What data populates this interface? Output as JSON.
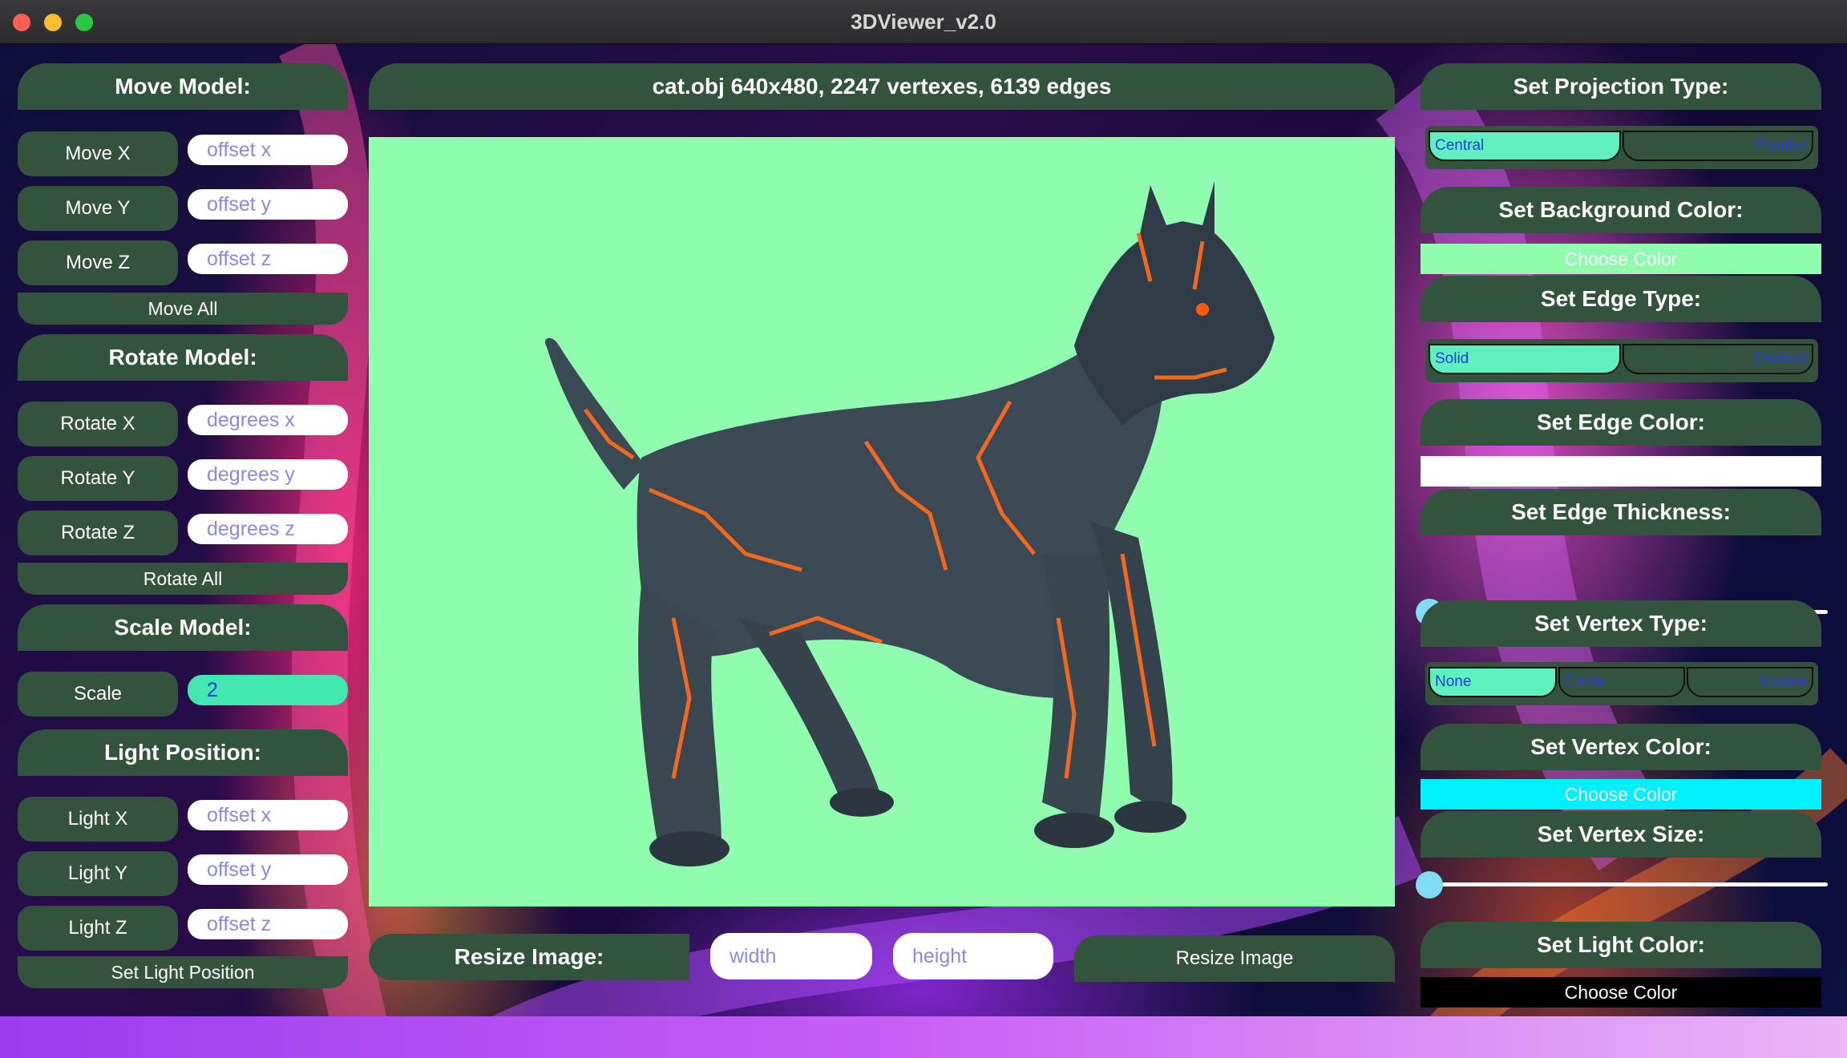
{
  "window": {
    "title": "3DViewer_v2.0"
  },
  "move": {
    "header": "Move Model:",
    "x_label": "Move X",
    "x_placeholder": "offset x",
    "y_label": "Move Y",
    "y_placeholder": "offset y",
    "z_label": "Move Z",
    "z_placeholder": "offset z",
    "all_label": "Move All"
  },
  "rotate": {
    "header": "Rotate Model:",
    "x_label": "Rotate X",
    "x_placeholder": "degrees x",
    "y_label": "Rotate Y",
    "y_placeholder": "degrees y",
    "z_label": "Rotate Z",
    "z_placeholder": "degrees z",
    "all_label": "Rotate All"
  },
  "scale": {
    "header": "Scale Model:",
    "label": "Scale",
    "value": "2"
  },
  "light": {
    "header": "Light Position:",
    "x_label": "Light X",
    "x_placeholder": "offset x",
    "y_label": "Light Y",
    "y_placeholder": "offset y",
    "z_label": "Light Z",
    "z_placeholder": "offset z",
    "set_label": "Set Light Position"
  },
  "model_info": "cat.obj 640x480, 2247 vertexes, 6139 edges",
  "resize": {
    "label": "Resize Image:",
    "width_placeholder": "width",
    "height_placeholder": "height",
    "button": "Resize Image"
  },
  "projection": {
    "header": "Set Projection Type:",
    "options": [
      "Central",
      "Parallel"
    ],
    "selected": "Central"
  },
  "background_color": {
    "header": "Set Background Color:",
    "button": "Choose Color",
    "color": "#8ffcb0"
  },
  "edge_type": {
    "header": "Set Edge Type:",
    "options": [
      "Solid",
      "Dashed"
    ],
    "selected": "Solid"
  },
  "edge_color": {
    "header": "Set Edge Color:",
    "color": "#ffffff"
  },
  "edge_thickness": {
    "header": "Set Edge Thickness:",
    "level": 0
  },
  "vertex_type": {
    "header": "Set Vertex Type:",
    "options": [
      "None",
      "Circle",
      "Square"
    ],
    "selected": "None"
  },
  "vertex_color": {
    "header": "Set Vertex Color:",
    "button": "Choose Color",
    "color": "#00f0ff"
  },
  "vertex_size": {
    "header": "Set  Vertex Size:",
    "level": 0
  },
  "light_color": {
    "header": "Set Light Color:",
    "button": "Choose Color",
    "color": "#000000"
  },
  "colors": {
    "panel": "#33533d",
    "accent_teal": "#40e8b0",
    "viewport_bg": "#8ffcb0"
  }
}
